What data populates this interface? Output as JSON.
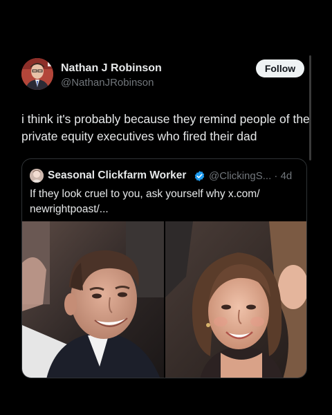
{
  "author": {
    "display_name": "Nathan J Robinson",
    "handle": "@NathanJRobinson",
    "avatar_icon": "person-avatar"
  },
  "follow": {
    "label": "Follow"
  },
  "tweet": {
    "text": "i think it's probably because they remind people of the private equity executives who fired their dad"
  },
  "quoted_tweet": {
    "display_name": "Seasonal Clickfarm Worker",
    "verified_icon": "verified-badge-icon",
    "handle_time": "@ClickingS... · 4d",
    "text": "If they look cruel to you, ask yourself why x.com/ newrightpoast/...",
    "images": [
      {
        "icon": "photo-man-smiling"
      },
      {
        "icon": "photo-woman-smiling"
      }
    ]
  },
  "colors": {
    "background": "#000000",
    "text_primary": "#e7e9ea",
    "text_secondary": "#71767b",
    "border": "#2f3336",
    "follow_bg": "#eff3f4",
    "verified_blue": "#1d9bf0"
  }
}
